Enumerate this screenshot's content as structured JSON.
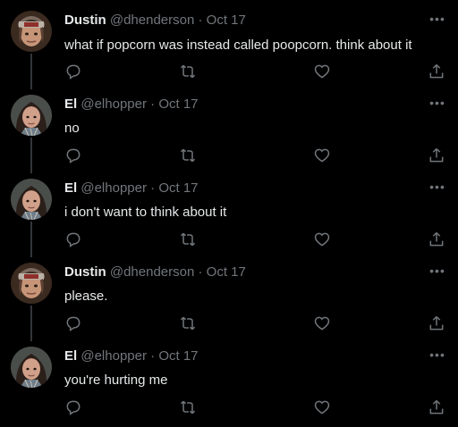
{
  "tweets": [
    {
      "name": "Dustin",
      "handle": "@dhenderson",
      "separator": "·",
      "date": "Oct 17",
      "text": "what if popcorn was instead called poopcorn. think about it",
      "avatar_icon": "avatar-dustin"
    },
    {
      "name": "El",
      "handle": "@elhopper",
      "separator": "·",
      "date": "Oct 17",
      "text": "no",
      "avatar_icon": "avatar-el"
    },
    {
      "name": "El",
      "handle": "@elhopper",
      "separator": "·",
      "date": "Oct 17",
      "text": "i don't want to think about it",
      "avatar_icon": "avatar-el"
    },
    {
      "name": "Dustin",
      "handle": "@dhenderson",
      "separator": "·",
      "date": "Oct 17",
      "text": "please.",
      "avatar_icon": "avatar-dustin"
    },
    {
      "name": "El",
      "handle": "@elhopper",
      "separator": "·",
      "date": "Oct 17",
      "text": "you're hurting me",
      "avatar_icon": "avatar-el"
    }
  ],
  "icons": {
    "more": "more-icon",
    "reply": "reply-icon",
    "retweet": "retweet-icon",
    "like": "like-icon",
    "share": "share-icon"
  },
  "colors": {
    "background": "#000000",
    "text_primary": "#e7e9ea",
    "text_secondary": "#71767b",
    "thread_line": "#333639"
  }
}
